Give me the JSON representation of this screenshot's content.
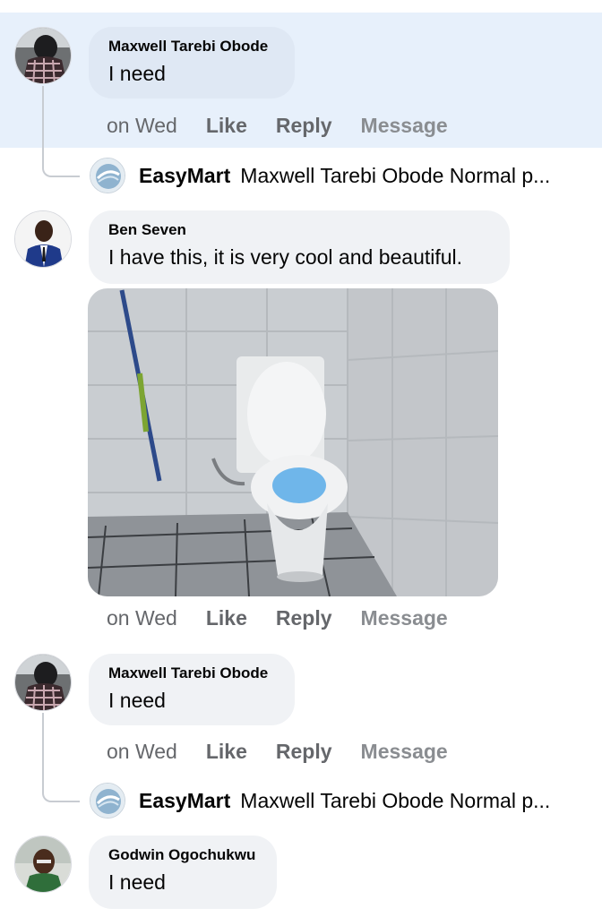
{
  "comments": [
    {
      "author": "Maxwell Tarebi Obode",
      "text": "I need",
      "time": "on Wed",
      "like": "Like",
      "reply": "Reply",
      "message": "Message"
    },
    {
      "author": "Ben Seven",
      "text": "I have this, it is very cool and beautiful.",
      "time": "on Wed",
      "like": "Like",
      "reply": "Reply",
      "message": "Message",
      "attachment": "toilet-photo"
    },
    {
      "author": "Maxwell Tarebi Obode",
      "text": "I need",
      "time": "on Wed",
      "like": "Like",
      "reply": "Reply",
      "message": "Message"
    },
    {
      "author": "Godwin Ogochukwu",
      "text": "I need"
    }
  ],
  "replies": [
    {
      "author": "EasyMart",
      "text": "Maxwell Tarebi Obode Normal p..."
    },
    {
      "author": "EasyMart",
      "text": "Maxwell Tarebi Obode Normal p..."
    }
  ],
  "colors": {
    "highlight": "#e7f0fb",
    "bubble": "#f0f2f5",
    "meta_text": "#65676b"
  }
}
